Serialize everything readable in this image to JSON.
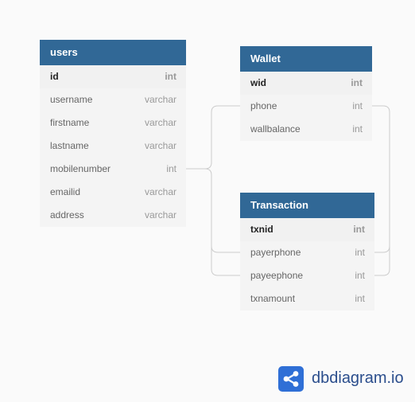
{
  "tables": {
    "users": {
      "title": "users",
      "fields": [
        {
          "name": "id",
          "type": "int",
          "pk": true
        },
        {
          "name": "username",
          "type": "varchar"
        },
        {
          "name": "firstname",
          "type": "varchar"
        },
        {
          "name": "lastname",
          "type": "varchar"
        },
        {
          "name": "mobilenumber",
          "type": "int"
        },
        {
          "name": "emailid",
          "type": "varchar"
        },
        {
          "name": "address",
          "type": "varchar"
        }
      ]
    },
    "wallet": {
      "title": "Wallet",
      "fields": [
        {
          "name": "wid",
          "type": "int",
          "pk": true
        },
        {
          "name": "phone",
          "type": "int"
        },
        {
          "name": "wallbalance",
          "type": "int"
        }
      ]
    },
    "transaction": {
      "title": "Transaction",
      "fields": [
        {
          "name": "txnid",
          "type": "int",
          "pk": true
        },
        {
          "name": "payerphone",
          "type": "int"
        },
        {
          "name": "payeephone",
          "type": "int"
        },
        {
          "name": "txnamount",
          "type": "int"
        }
      ]
    }
  },
  "relationships": [
    {
      "from": "users.mobilenumber",
      "to": "wallet.phone"
    },
    {
      "from": "users.mobilenumber",
      "to": "transaction.payerphone"
    },
    {
      "from": "users.mobilenumber",
      "to": "transaction.payeephone"
    },
    {
      "from": "wallet.phone",
      "to": "transaction.payerphone"
    },
    {
      "from": "wallet.phone",
      "to": "transaction.payeephone"
    }
  ],
  "brand": {
    "name": "dbdiagram.io",
    "icon": "share-nodes-icon",
    "accent": "#2f6fd6",
    "header_color": "#316896"
  }
}
